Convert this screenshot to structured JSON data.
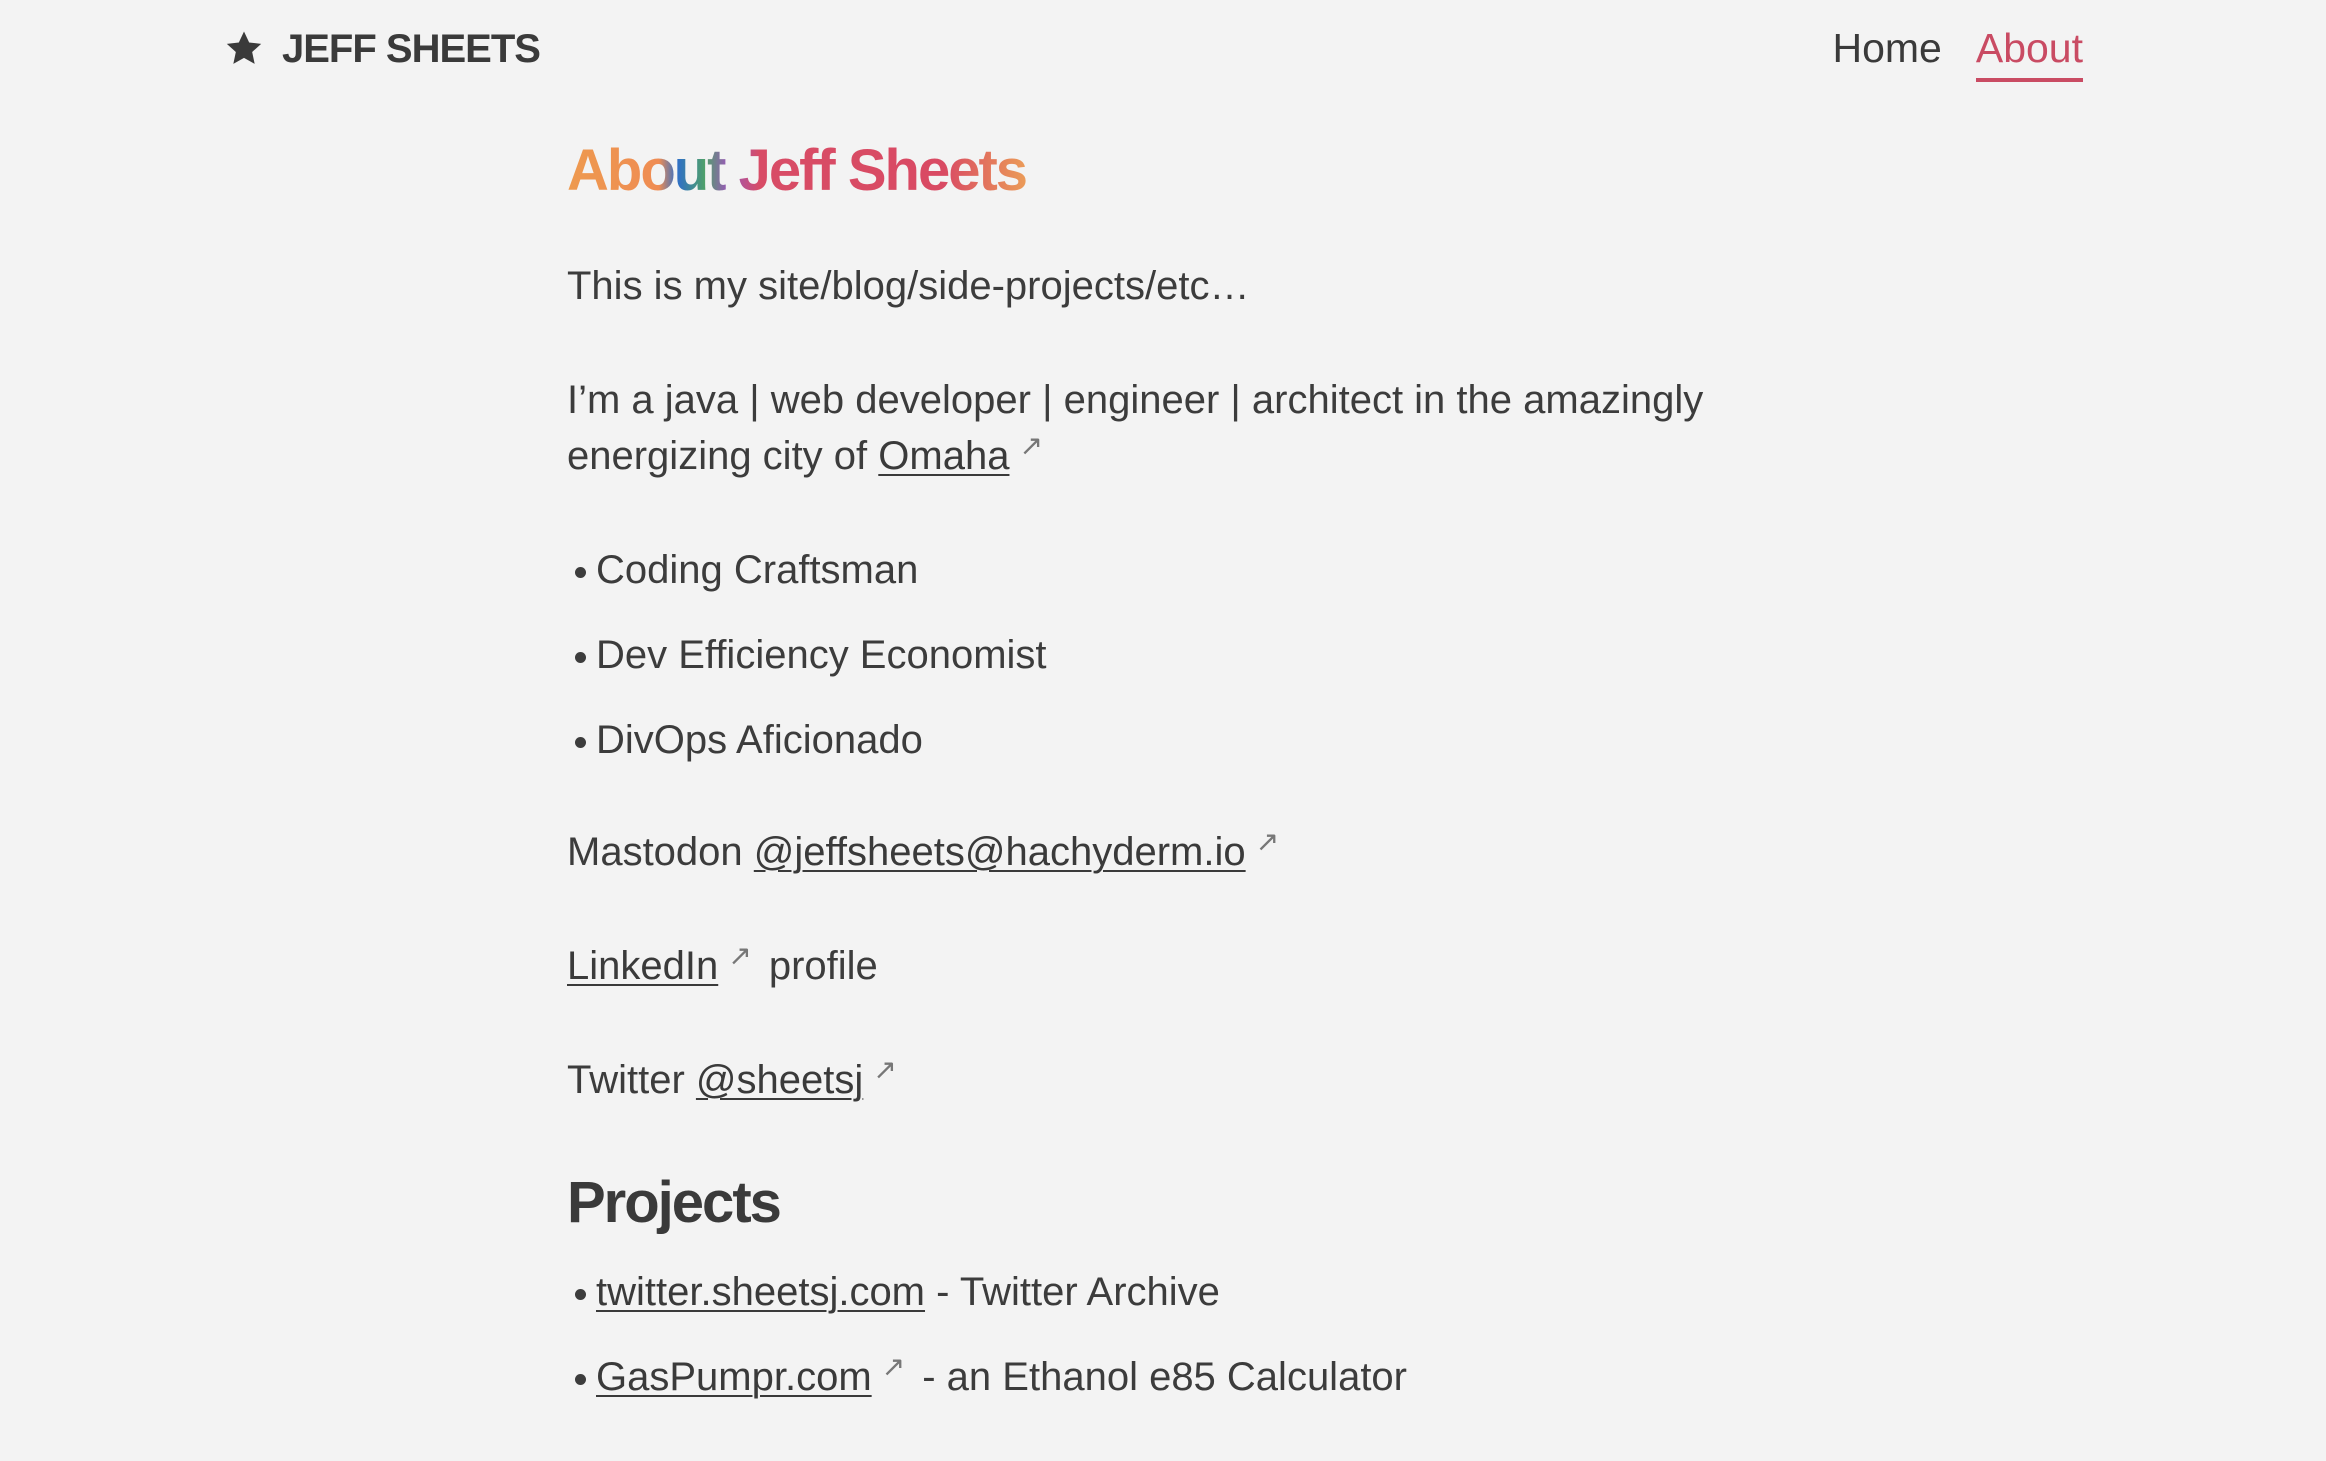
{
  "header": {
    "brand_name": "JEFF SHEETS",
    "nav": {
      "home_label": "Home",
      "about_label": "About"
    }
  },
  "colors": {
    "accent": "#c94b63",
    "background": "#f3f3f3",
    "text": "#3c3c3c"
  },
  "main": {
    "title": "About Jeff Sheets",
    "intro": "This is my site/blog/side-projects/etc…",
    "bio_text": "I’m a java | web developer | engineer | architect in the amazingly energizing city of",
    "bio_link": "Omaha",
    "roles": [
      "Coding Craftsman",
      "Dev Efficiency Economist",
      "DivOps Aficionado"
    ],
    "mastodon": {
      "label": "Mastodon",
      "handle": "@jeffsheets@hachyderm.io"
    },
    "linkedin": {
      "link": "LinkedIn",
      "suffix": "profile"
    },
    "twitter": {
      "label": "Twitter",
      "handle": "@sheetsj"
    },
    "projects_heading": "Projects",
    "projects": [
      {
        "link": "twitter.sheetsj.com",
        "desc": "- Twitter Archive"
      },
      {
        "link": "GasPumpr.com",
        "desc": "- an Ethanol e85 Calculator"
      }
    ]
  }
}
